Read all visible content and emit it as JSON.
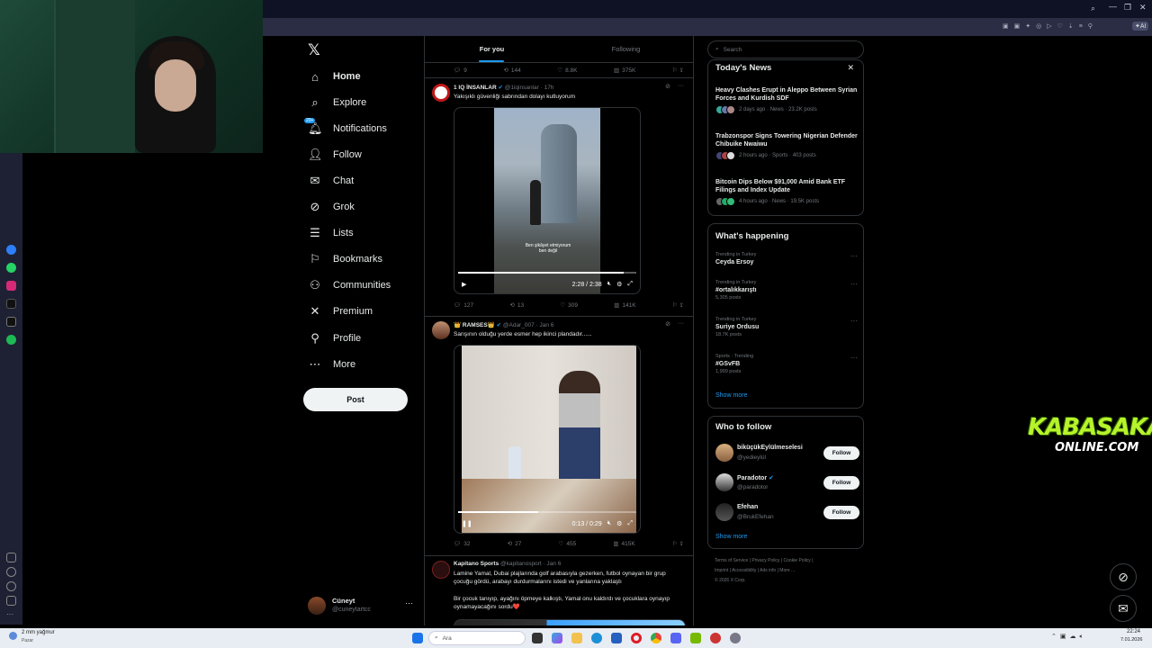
{
  "nav": {
    "items": [
      {
        "label": "Home",
        "icon": "home-icon"
      },
      {
        "label": "Explore",
        "icon": "search-icon"
      },
      {
        "label": "Notifications",
        "icon": "bell-icon",
        "badge": "20+"
      },
      {
        "label": "Follow",
        "icon": "person-plus-icon"
      },
      {
        "label": "Chat",
        "icon": "mail-icon"
      },
      {
        "label": "Grok",
        "icon": "grok-icon"
      },
      {
        "label": "Lists",
        "icon": "list-icon"
      },
      {
        "label": "Bookmarks",
        "icon": "bookmark-icon"
      },
      {
        "label": "Communities",
        "icon": "people-icon"
      },
      {
        "label": "Premium",
        "icon": "x-icon"
      },
      {
        "label": "Profile",
        "icon": "profile-icon"
      },
      {
        "label": "More",
        "icon": "more-circle-icon"
      }
    ],
    "post_label": "Post",
    "account": {
      "name": "Cüneyt",
      "handle": "@cuneytartcc"
    }
  },
  "feed": {
    "tabs": [
      "For you",
      "Following"
    ],
    "top_actions": {
      "replies": "9",
      "reposts": "144",
      "likes": "8.8K",
      "views": "375K"
    },
    "tweets": [
      {
        "name": "1 IQ İNSANLAR",
        "handle": "@1iqinsanlar",
        "time": "17h",
        "text": "Yakışıklı güvenliği sabrından dolayı kutluyorum",
        "video_time": "2:28 / 2:38",
        "video_progress": 0.93,
        "caption": "Ben şikâyet etmiyorum ben değil",
        "replies": "127",
        "reposts": "13",
        "likes": "309",
        "views": "141K"
      },
      {
        "name": "👑 RAMSES👑",
        "handle": "@Adar_007",
        "time": "Jan 6",
        "text": "Sarışının olduğu yerde esmer hep ikinci plandadır......",
        "video_time": "0:13 / 0:29",
        "video_progress": 0.45,
        "replies": "32",
        "reposts": "27",
        "likes": "455",
        "views": "415K"
      },
      {
        "name": "Kapitano Sports",
        "handle": "@kapitanosport",
        "time": "Jan 6",
        "text": "Lamine Yamal, Dubai plajlarında golf arabasıyla gezerken, futbol oynayan bir grup çocuğu gördü, arabayı durdurmalarını istedi ve yanlarına yaklaştı",
        "text2": "Bir çocuk tanıyıp, ayağını öpmeye kalkıştı, Yamal onu kaldırdı ve çocuklara oynayıp oynamayacağını sordu❤️"
      }
    ]
  },
  "sidebar": {
    "search_placeholder": "Search",
    "news_title": "Today's News",
    "news": [
      {
        "title": "Heavy Clashes Erupt in Aleppo Between Syrian Forces and Kurdish SDF",
        "meta": "2 days ago · News · 23.2K posts"
      },
      {
        "title": "Trabzonspor Signs Towering Nigerian Defender Chibuike Nwaiwu",
        "meta": "2 hours ago · Sports · 403 posts"
      },
      {
        "title": "Bitcoin Dips Below $91,000 Amid Bank ETF Filings and Index Update",
        "meta": "4 hours ago · News · 19.5K posts"
      }
    ],
    "happening_title": "What's happening",
    "trends": [
      {
        "context": "Trending in Turkey",
        "name": "Ceyda Ersoy",
        "posts": ""
      },
      {
        "context": "Trending in Turkey",
        "name": "#ortalıkkarıştı",
        "posts": "5,305 posts"
      },
      {
        "context": "Trending in Turkey",
        "name": "Suriye Ordusu",
        "posts": "18.7K posts"
      },
      {
        "context": "Sports · Trending",
        "name": "#GSvFB",
        "posts": "1,999 posts"
      }
    ],
    "show_more": "Show more",
    "wtf_title": "Who to follow",
    "who_to_follow": [
      {
        "name": "biküçükEylülmeselesi",
        "handle": "@yedieylül",
        "button": "Follow"
      },
      {
        "name": "Paradotor",
        "handle": "@paradotor",
        "button": "Follow"
      },
      {
        "name": "Efehan",
        "handle": "@BrukEfehan",
        "button": "Follow"
      }
    ],
    "footer": [
      "Terms of Service",
      "Privacy Policy",
      "Cookie Policy",
      "Imprint",
      "Accessibility",
      "Ads info",
      "More ...",
      "© 2026 X Corp."
    ]
  },
  "overlay": {
    "logo_line1": "KABASAKAL",
    "logo_line2": "ONLINE.COM"
  },
  "taskbar": {
    "weather": "2 mm yağmur",
    "weather_sub": "Pazar",
    "search_label": "Ara",
    "time": "22:24",
    "date": "7.01.2026"
  },
  "colors": {
    "accent": "#1d9bf0",
    "background": "#000000",
    "logo_green": "#b7f32a"
  }
}
